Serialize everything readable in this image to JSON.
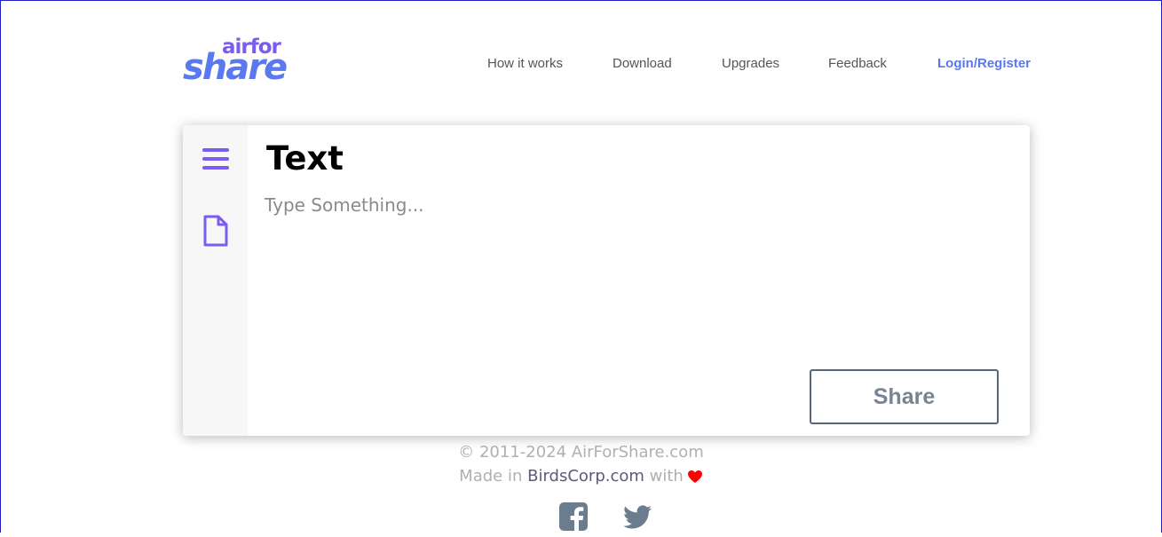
{
  "header": {
    "logo_top": "airfor",
    "logo_bottom": "share",
    "nav": [
      {
        "label": "How it works"
      },
      {
        "label": "Download"
      },
      {
        "label": "Upgrades"
      },
      {
        "label": "Feedback"
      },
      {
        "label": "Login/Register"
      }
    ]
  },
  "sidebar": {
    "icons": [
      "menu-icon",
      "file-icon"
    ]
  },
  "main": {
    "title": "Text",
    "input_placeholder": "Type Something...",
    "input_value": "",
    "share_label": "Share"
  },
  "footer": {
    "copyright": "© 2011-2024 AirForShare.com",
    "made_in_prefix": "Made in ",
    "made_in_link": "BirdsCorp.com",
    "made_in_suffix": " with",
    "social": [
      "facebook-icon",
      "twitter-icon"
    ]
  },
  "colors": {
    "accent": "#7b5cf0",
    "brand_blue": "#5a78f0",
    "share_text": "#778494",
    "heart": "#ff0000"
  }
}
